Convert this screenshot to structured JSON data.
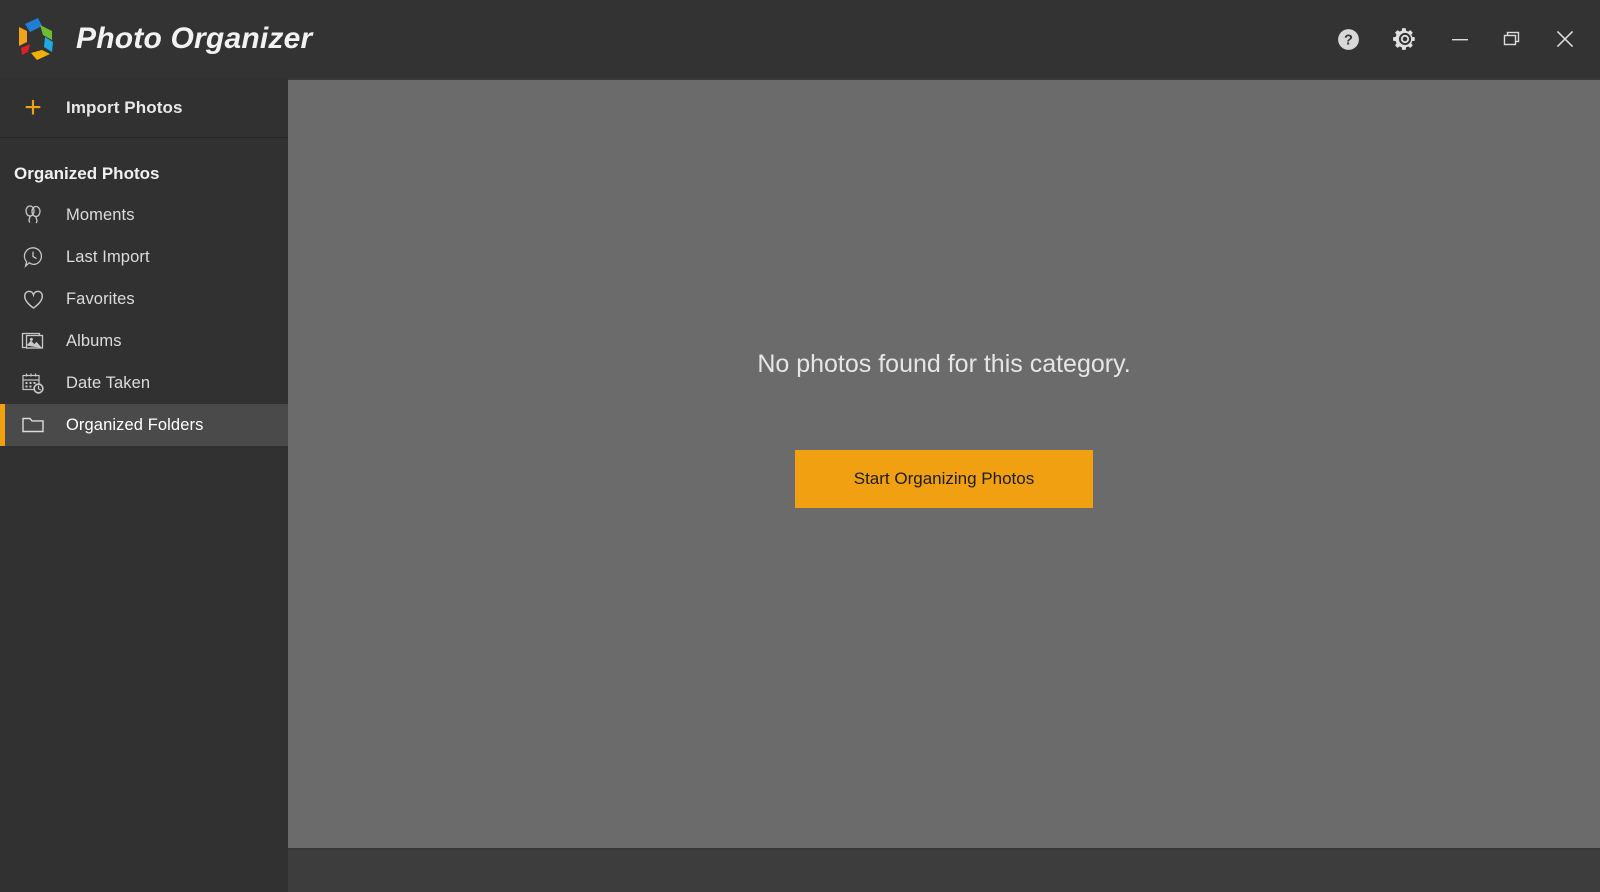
{
  "window": {
    "app_title": "Photo Organizer",
    "logo_icon": "hexagon-ring-logo",
    "controls": [
      {
        "name": "help-button",
        "icon": "help-circle-icon",
        "label": "?"
      },
      {
        "name": "settings-button",
        "icon": "gear-icon",
        "label": ""
      },
      {
        "name": "minimize-button",
        "icon": "minimize-icon",
        "label": ""
      },
      {
        "name": "restore-button",
        "icon": "restore-window-icon",
        "label": ""
      },
      {
        "name": "close-button",
        "icon": "close-icon",
        "label": ""
      }
    ]
  },
  "sidebar": {
    "import": {
      "label": "Import Photos",
      "icon": "plus-icon",
      "plus_glyph": "+",
      "accent_color": "#f0a010"
    },
    "section_title": "Organized Photos",
    "items": [
      {
        "label": "Moments",
        "icon": "balloons-icon",
        "selected": false
      },
      {
        "label": "Last Import",
        "icon": "clock-tag-icon",
        "selected": false
      },
      {
        "label": "Favorites",
        "icon": "heart-icon",
        "selected": false
      },
      {
        "label": "Albums",
        "icon": "photo-stack-icon",
        "selected": false
      },
      {
        "label": "Date Taken",
        "icon": "calendar-clock-icon",
        "selected": false
      },
      {
        "label": "Organized Folders",
        "icon": "folder-icon",
        "selected": true
      }
    ]
  },
  "main": {
    "empty_message": "No photos found for this category.",
    "cta_label": "Start Organizing Photos",
    "cta_color": "#f0a010",
    "background_color": "#6b6b6b"
  },
  "theme": {
    "titlebar_color": "#333333",
    "sidebar_color": "#313131",
    "selected_row_color": "#4a4a4a",
    "accent_color": "#f0a010",
    "text_color": "#dcdcdc"
  }
}
